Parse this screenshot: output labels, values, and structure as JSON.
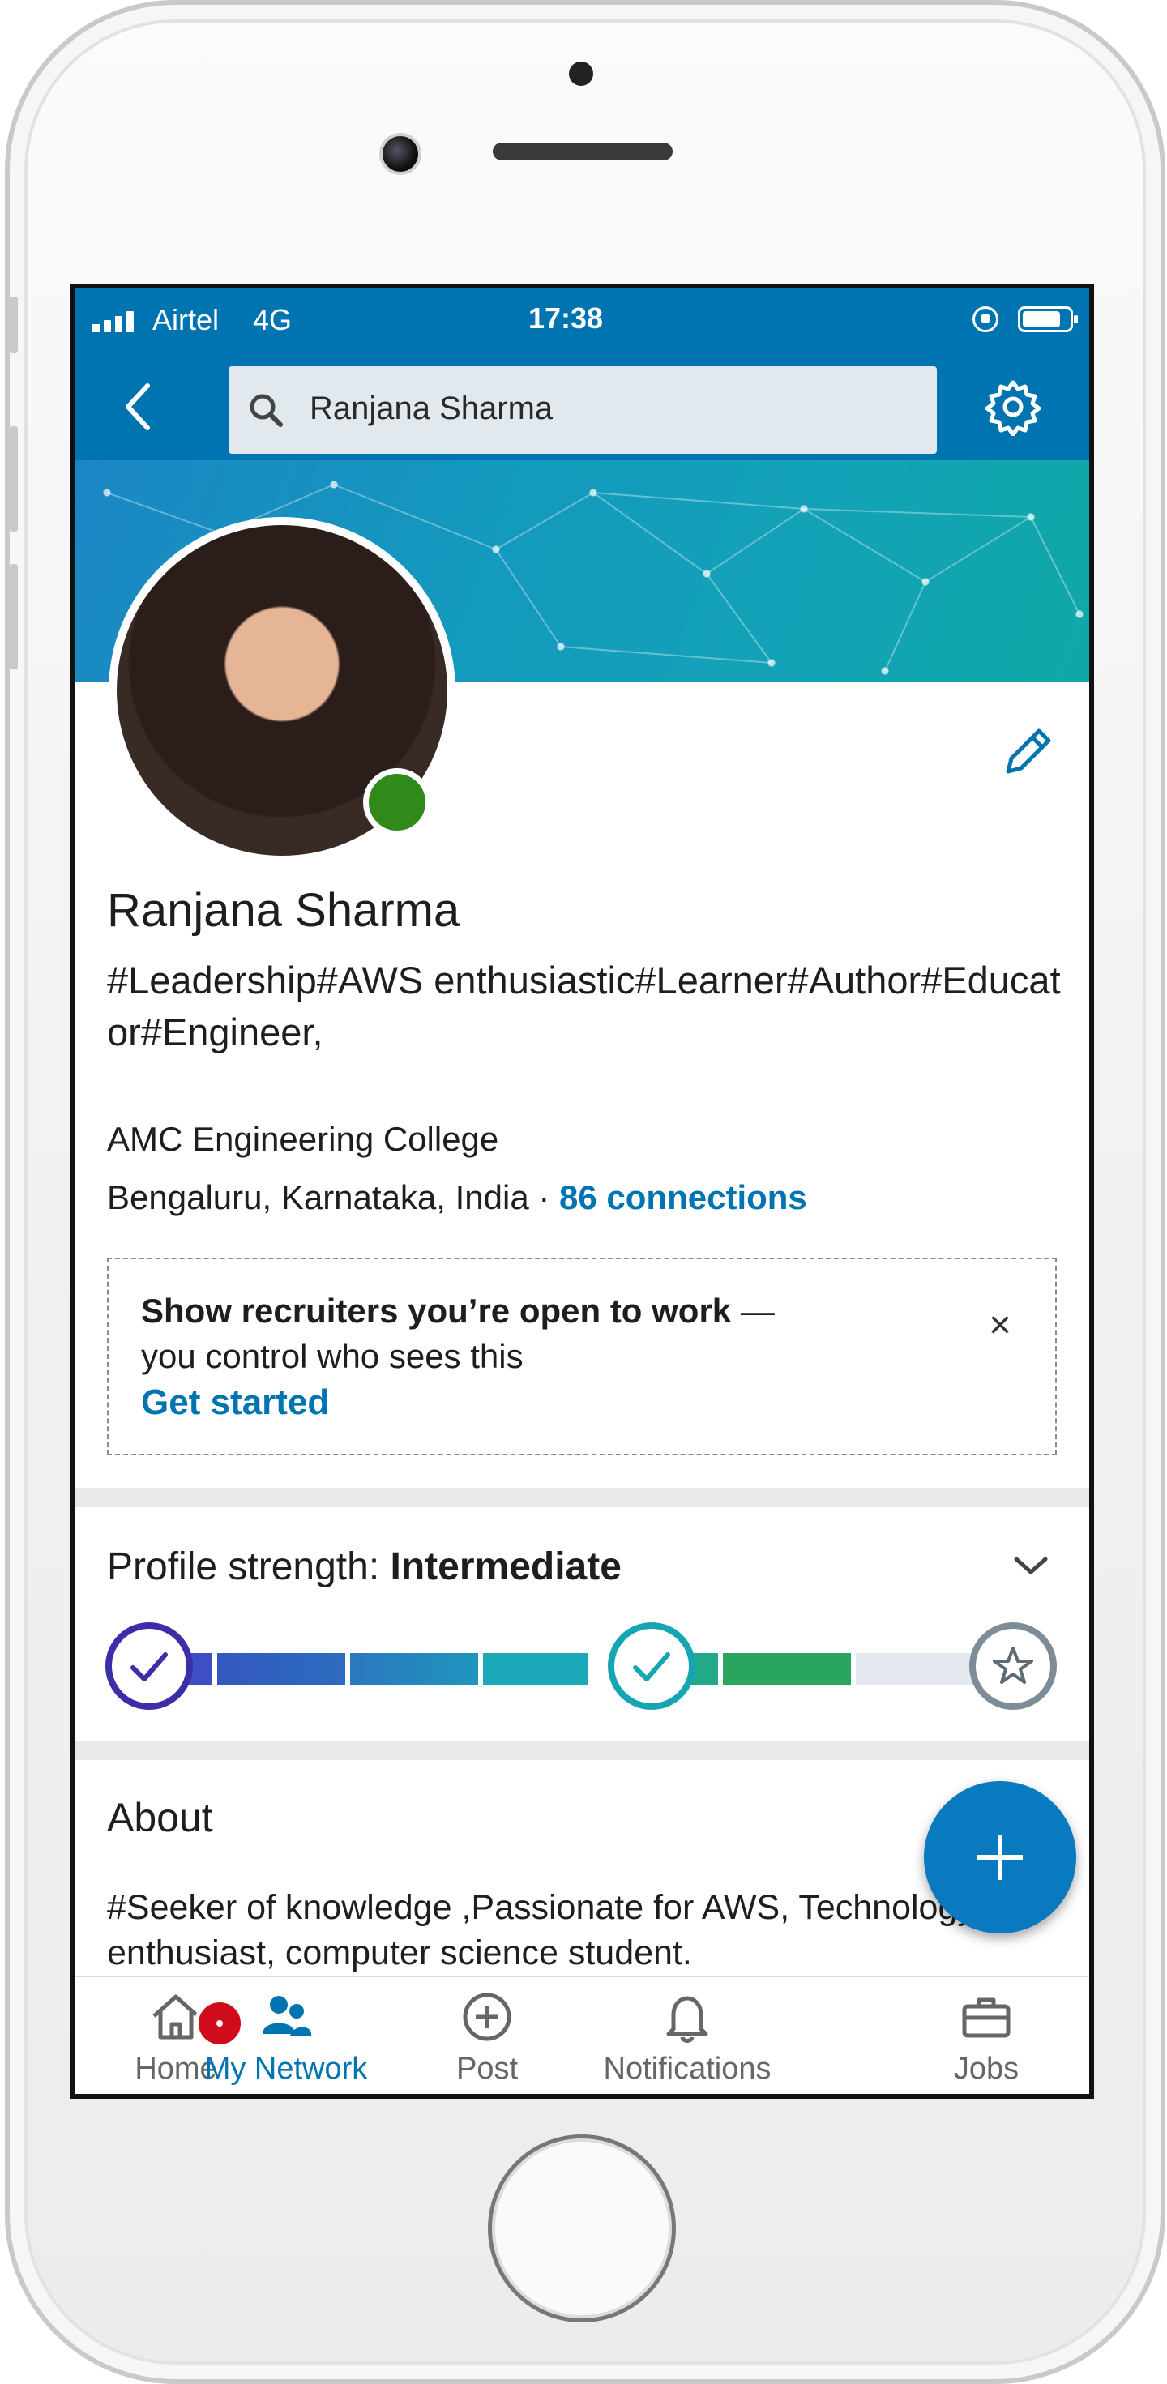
{
  "status_bar": {
    "carrier": "Airtel",
    "network": "4G",
    "time": "17:38"
  },
  "search": {
    "query": "Ranjana Sharma"
  },
  "profile": {
    "name": "Ranjana Sharma",
    "headline": "#Leadership#AWS enthusiastic#Learner#Author#Educator#Engineer,",
    "school": "AMC Engineering College",
    "location": "Bengaluru, Karnataka, India",
    "separator": " · ",
    "connections": "86 connections"
  },
  "open_to_work": {
    "title": "Show recruiters you’re open to work",
    "dash": " —",
    "subtitle": "you control who sees this",
    "cta": "Get started",
    "close": "×"
  },
  "profile_strength": {
    "label": "Profile strength: ",
    "level": "Intermediate",
    "steps_completed": 2,
    "steps_total": 3
  },
  "about": {
    "heading": "About",
    "text": "#Seeker of knowledge ,Passionate for AWS, Technology enthusiast, computer science student."
  },
  "tabs": [
    {
      "label": "Home",
      "icon": "home-icon"
    },
    {
      "label": "My Network",
      "icon": "network-icon",
      "active": true
    },
    {
      "label": "Post",
      "icon": "post-icon"
    },
    {
      "label": "Notifications",
      "icon": "bell-icon"
    },
    {
      "label": "Jobs",
      "icon": "briefcase-icon"
    }
  ],
  "colors": {
    "brand": "#0073b1",
    "online": "#2f8a1a",
    "badge": "#cf0b1c"
  }
}
